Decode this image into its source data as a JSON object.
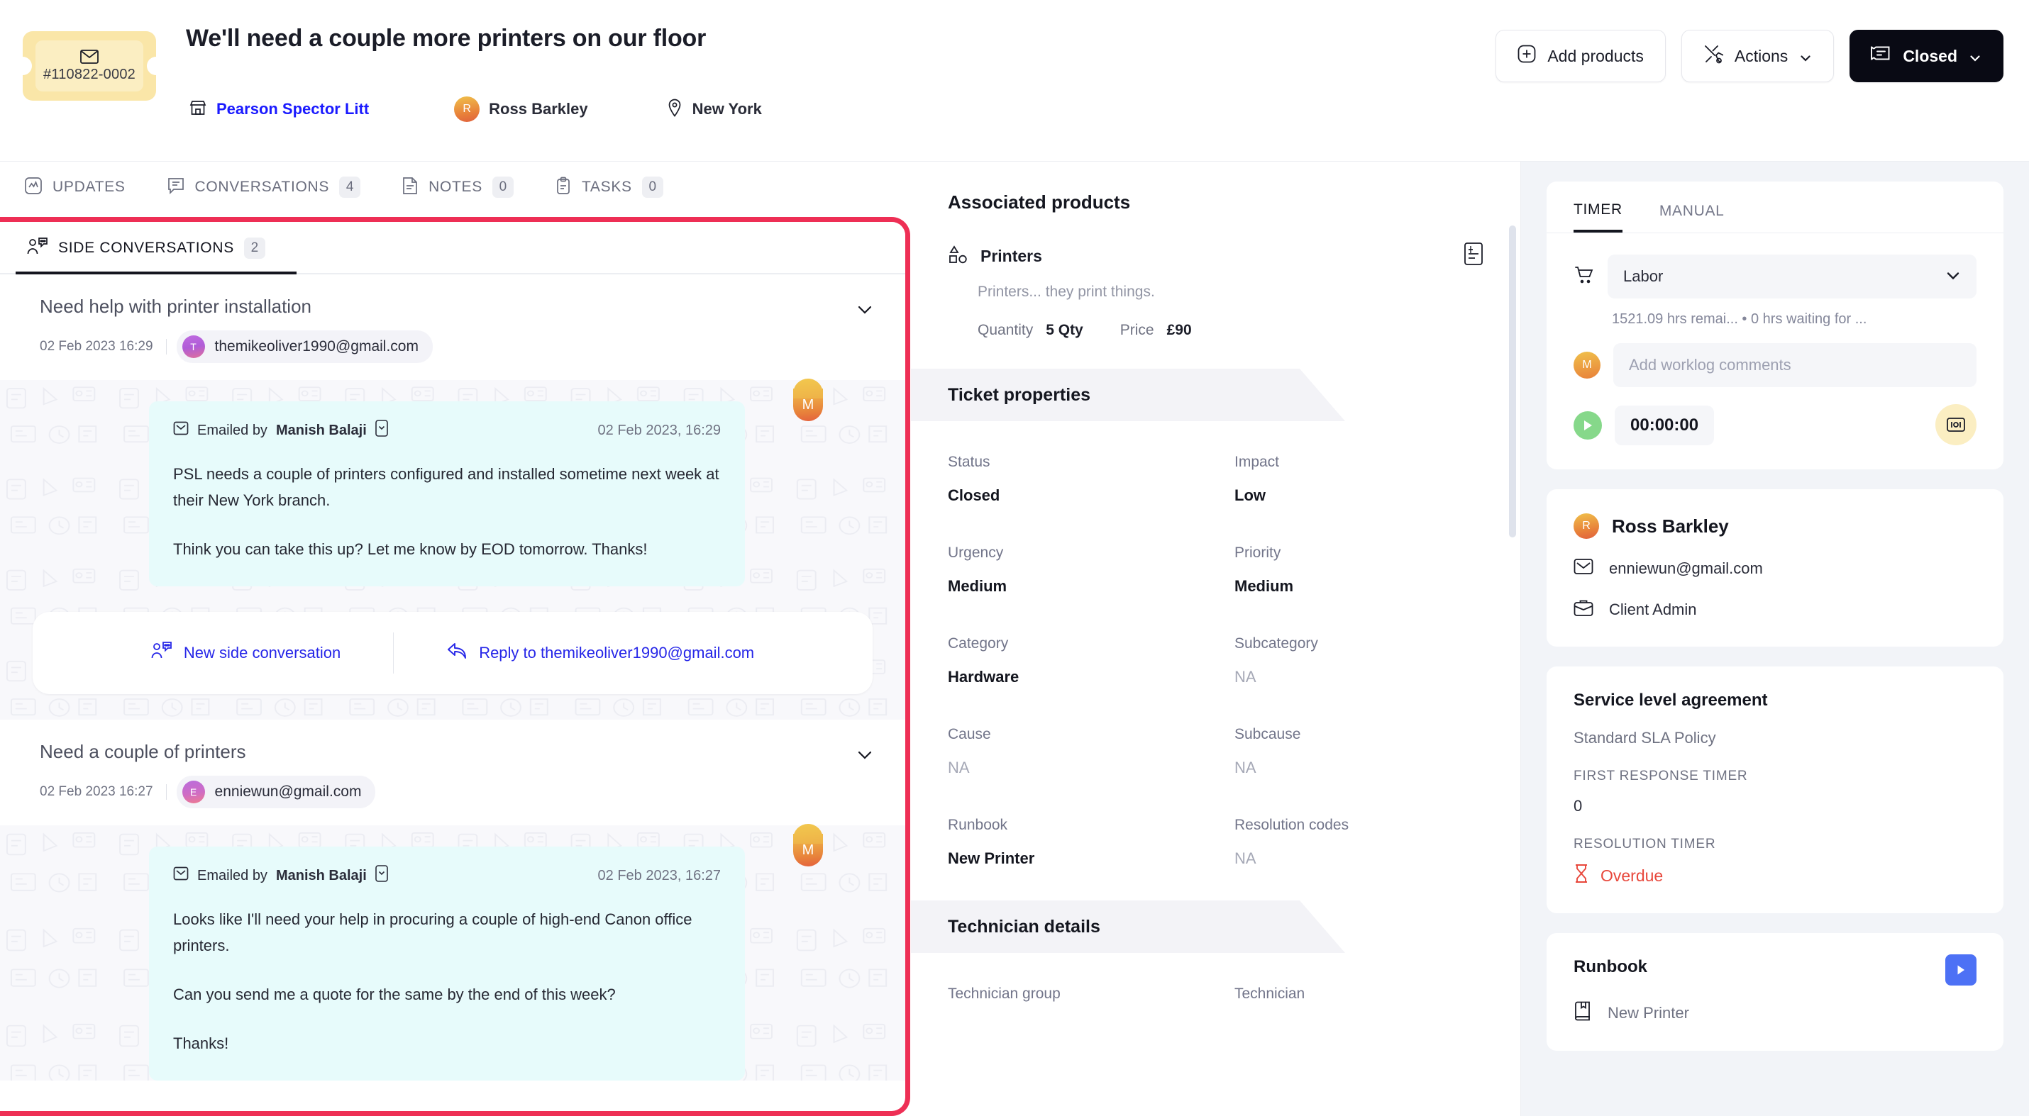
{
  "header": {
    "ticket_number": "#110822-0002",
    "ticket_icon": "envelope-icon",
    "title": "We'll need a couple more printers on our floor",
    "account": "Pearson Spector Litt",
    "account_icon": "storefront-icon",
    "requester": "Ross Barkley",
    "requester_initial": "R",
    "location": "New York",
    "location_icon": "map-pin-icon",
    "buttons": {
      "add_products": "Add products",
      "actions": "Actions",
      "status": "Closed"
    }
  },
  "tabs": [
    {
      "label": "UPDATES",
      "badge": "",
      "icon": "activity-icon"
    },
    {
      "label": "CONVERSATIONS",
      "badge": "4",
      "icon": "chat-icon"
    },
    {
      "label": "NOTES",
      "badge": "0",
      "icon": "note-icon"
    },
    {
      "label": "TASKS",
      "badge": "0",
      "icon": "clipboard-icon"
    }
  ],
  "side_conversations": {
    "tab_label": "SIDE CONVERSATIONS",
    "tab_badge": "2",
    "items": [
      {
        "title": "Need help with printer installation",
        "date": "02 Feb 2023 16:29",
        "email": "themikeoliver1990@gmail.com",
        "email_initial": "T",
        "message": {
          "by_prefix": "Emailed by",
          "by_name": "Manish Balaji",
          "time": "02 Feb 2023, 16:29",
          "avatar_initial": "M",
          "paragraphs": [
            "PSL needs a couple of printers configured and installed sometime next week at their New York branch.",
            "Think you can take this up? Let me know by EOD tomorrow. Thanks!"
          ]
        },
        "actions": {
          "new": "New side conversation",
          "reply": "Reply to themikeoliver1990@gmail.com"
        }
      },
      {
        "title": "Need a couple of printers",
        "date": "02 Feb 2023 16:27",
        "email": "enniewun@gmail.com",
        "email_initial": "E",
        "message": {
          "by_prefix": "Emailed by",
          "by_name": "Manish Balaji",
          "time": "02 Feb 2023, 16:27",
          "avatar_initial": "M",
          "paragraphs": [
            "Looks like I'll need your help in procuring a couple of high-end Canon office printers.",
            "Can you send me a quote for the same by the end of this week?",
            "Thanks!"
          ]
        }
      }
    ]
  },
  "middle": {
    "associated_products_title": "Associated products",
    "product": {
      "name": "Printers",
      "description": "Printers... they print things.",
      "quantity_label": "Quantity",
      "quantity_value": "5 Qty",
      "price_label": "Price",
      "price_value": "£90"
    },
    "ticket_properties_title": "Ticket properties",
    "fields": [
      {
        "label": "Status",
        "value": "Closed",
        "na": false
      },
      {
        "label": "Impact",
        "value": "Low",
        "na": false
      },
      {
        "label": "Urgency",
        "value": "Medium",
        "na": false
      },
      {
        "label": "Priority",
        "value": "Medium",
        "na": false
      },
      {
        "label": "Category",
        "value": "Hardware",
        "na": false
      },
      {
        "label": "Subcategory",
        "value": "NA",
        "na": true
      },
      {
        "label": "Cause",
        "value": "NA",
        "na": true
      },
      {
        "label": "Subcause",
        "value": "NA",
        "na": true
      },
      {
        "label": "Runbook",
        "value": "New Printer",
        "na": false
      },
      {
        "label": "Resolution codes",
        "value": "NA",
        "na": true
      }
    ],
    "technician_details_title": "Technician details",
    "tech_fields": [
      {
        "label": "Technician group"
      },
      {
        "label": "Technician"
      }
    ]
  },
  "right": {
    "timelog": {
      "tab_timer": "TIMER",
      "tab_manual": "MANUAL",
      "category": "Labor",
      "hint": "1521.09 hrs remai...  •  0 hrs waiting for ...",
      "comment_placeholder": "Add worklog comments",
      "avatar_initial": "M",
      "timer_value": "00:00:00"
    },
    "contact": {
      "name": "Ross Barkley",
      "initial": "R",
      "email": "enniewun@gmail.com",
      "role": "Client Admin"
    },
    "sla": {
      "title": "Service level agreement",
      "policy": "Standard SLA Policy",
      "first_response_label": "FIRST RESPONSE TIMER",
      "first_response_value": "0",
      "resolution_label": "RESOLUTION TIMER",
      "resolution_value": "Overdue"
    },
    "runbook": {
      "title": "Runbook",
      "item": "New Printer"
    }
  },
  "colors": {
    "highlight": "#ee2f55",
    "link": "#1a1aff",
    "overdue": "#e8483c",
    "bubble": "#e7fbfb",
    "dark_button": "#090a14"
  }
}
